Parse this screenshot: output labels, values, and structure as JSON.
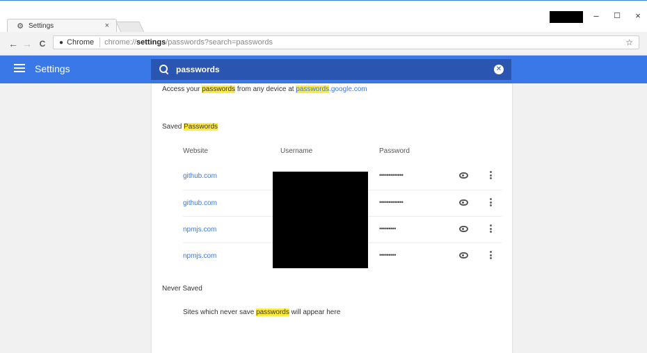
{
  "tab": {
    "title": "Settings",
    "close": "×"
  },
  "window_controls": {
    "minimize": "–",
    "maximize": "☐",
    "close": "×"
  },
  "nav": {
    "back": "←",
    "forward": "→",
    "reload": "C",
    "star": "☆"
  },
  "omnibox": {
    "chip_label": "Chrome",
    "url_scheme": "chrome://",
    "url_host": "settings",
    "url_path": "/passwords?search=passwords"
  },
  "header": {
    "title": "Settings"
  },
  "search": {
    "value": "passwords",
    "clear": "✕"
  },
  "sync_line": {
    "prefix": "Access your ",
    "hl1": "passwords",
    "middle": " from any device at ",
    "hl2": "passwords",
    "suffix": ".google.com"
  },
  "saved": {
    "title_prefix": "Saved ",
    "title_hl": "Passwords",
    "columns": {
      "website": "Website",
      "username": "Username",
      "password": "Password"
    },
    "rows": [
      {
        "site": "github.com",
        "password": "•••••••••••••"
      },
      {
        "site": "github.com",
        "password": "•••••••••••••"
      },
      {
        "site": "npmjs.com",
        "password": "•••••••••"
      },
      {
        "site": "npmjs.com",
        "password": "•••••••••"
      }
    ]
  },
  "never_saved": {
    "title": "Never Saved",
    "text_prefix": "Sites which never save ",
    "text_hl": "passwords",
    "text_suffix": " will appear here"
  },
  "colors": {
    "header_blue": "#3b78e7",
    "search_blue": "#2a55b0",
    "highlight": "#ffeb3b",
    "link": "#3b78e7"
  }
}
